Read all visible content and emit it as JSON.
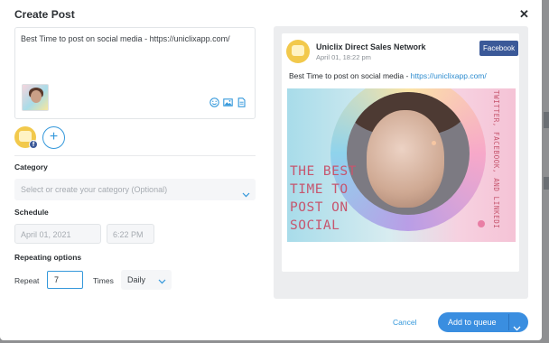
{
  "modal": {
    "title": "Create Post",
    "close_glyph": "✕"
  },
  "composer": {
    "text": "Best Time to post on social media - https://uniclixapp.com/",
    "icons": [
      "emoji-icon",
      "image-icon",
      "document-icon"
    ]
  },
  "accounts": {
    "add_glyph": "+",
    "badge_glyph": "f"
  },
  "category": {
    "label": "Category",
    "placeholder": "Select or create your category (Optional)"
  },
  "schedule": {
    "label": "Schedule",
    "date": "April 01, 2021",
    "time": "6:22 PM"
  },
  "repeating": {
    "label": "Repeating options",
    "repeat_label": "Repeat",
    "repeat_value": "7",
    "times_label": "Times",
    "frequency": "Daily"
  },
  "preview": {
    "page_name": "Uniclix Direct Sales Network",
    "date": "April 01, 18:22 pm",
    "network_badge": "Facebook",
    "text_prefix": "Best Time to post on social media - ",
    "link": "https://uniclixapp.com/",
    "image": {
      "headline": "THE BEST\nTIME TO\nPOST ON\nSOCIAL",
      "side_text": "TWITTER, FACEBOOK, AND LINKEDI"
    }
  },
  "footer": {
    "cancel_label": "Cancel",
    "submit_label": "Add to queue"
  },
  "colors": {
    "accent": "#3a8ee0",
    "facebook": "#3b5998",
    "headline": "#c6566e"
  }
}
